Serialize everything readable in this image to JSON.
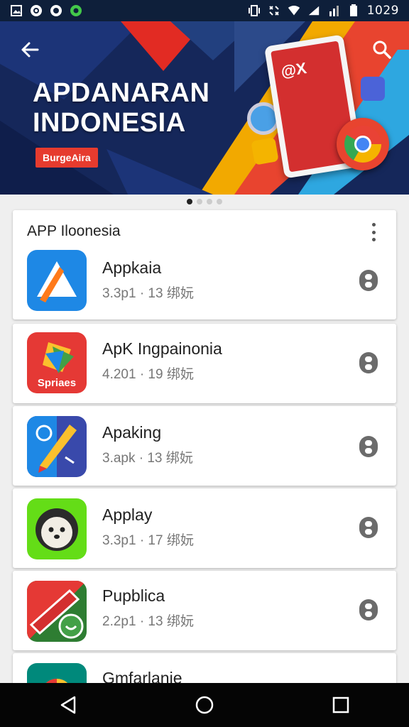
{
  "status_bar": {
    "time": "1029",
    "left_icons": [
      "gallery-icon",
      "eye-icon",
      "eye-icon",
      "notification-icon"
    ],
    "right_icons": [
      "vibrate-icon",
      "data-icon",
      "wifi-icon",
      "signal-icon",
      "battery-icon"
    ]
  },
  "banner": {
    "title_line1": "APDANARAN",
    "title_line2": "INDONESIA",
    "cta": "BurgeAira",
    "phone_logo": "@X",
    "colors": {
      "bg": "#15275a",
      "accent_red": "#e63b2e",
      "accent_yellow": "#f2a900"
    }
  },
  "pager": {
    "count": 4,
    "active": 0
  },
  "list": {
    "header": "APP Iloonesia",
    "apps": [
      {
        "name": "Appkaia",
        "meta": "3.3p1 · 13 绑妧",
        "icon": "triangle-app-icon",
        "color": "#1e88e5"
      },
      {
        "name": "ApK Ingpainonia",
        "meta": "4.201 · 19 绑妧",
        "icon": "sprite-app-icon",
        "color": "#e53935",
        "icon_text": "Spriaes"
      },
      {
        "name": "Apaking",
        "meta": "3.apk · 13 绑妧",
        "icon": "pen-app-icon",
        "color": "#3949ab"
      },
      {
        "name": "Applay",
        "meta": "3.3p1 · 17 绑妧",
        "icon": "android-app-icon",
        "color": "#64dd17"
      },
      {
        "name": "Pupblica",
        "meta": "2.2p1 · 13 绑妧",
        "icon": "pencil-app-icon",
        "color": "#2e7d32"
      },
      {
        "name": "Gmfarlanie",
        "meta": "",
        "icon": "partial-app-icon",
        "color": "#00897b"
      }
    ]
  },
  "nav": [
    "back-icon",
    "home-icon",
    "recents-icon"
  ]
}
